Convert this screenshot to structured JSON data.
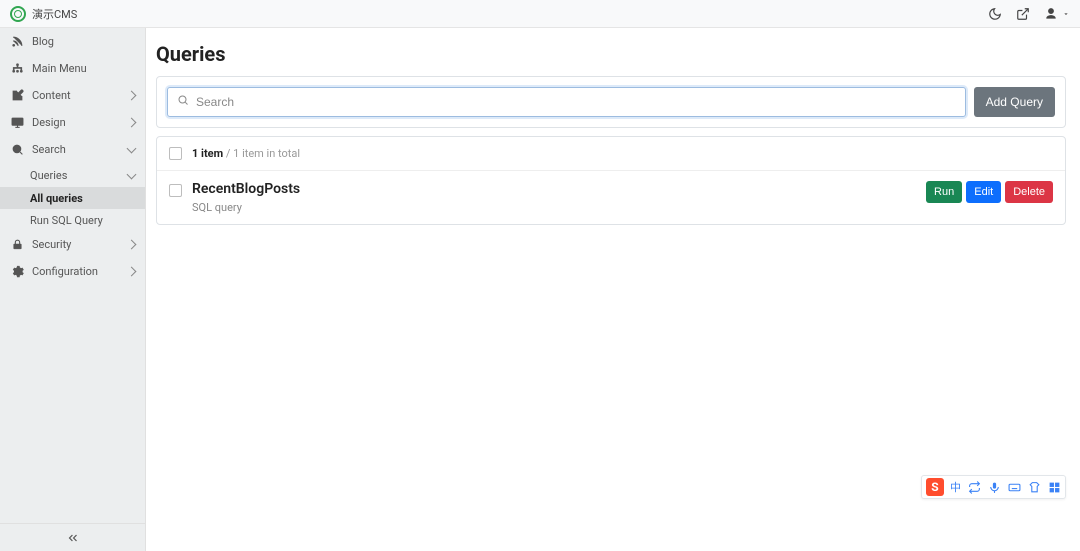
{
  "header": {
    "title": "演示CMS"
  },
  "sidebar": {
    "items": [
      {
        "label": "Blog"
      },
      {
        "label": "Main Menu"
      },
      {
        "label": "Content"
      },
      {
        "label": "Design"
      },
      {
        "label": "Search",
        "children": [
          {
            "label": "Queries",
            "children": [
              {
                "label": "All queries",
                "active": true
              },
              {
                "label": "Run SQL Query"
              }
            ]
          }
        ]
      },
      {
        "label": "Security"
      },
      {
        "label": "Configuration"
      }
    ]
  },
  "main": {
    "title": "Queries",
    "search_placeholder": "Search",
    "add_button": "Add Query",
    "list": {
      "count_number": "1 item",
      "count_rest": " / 1 item in total",
      "rows": [
        {
          "title": "RecentBlogPosts",
          "subtitle": "SQL query",
          "actions": {
            "run": "Run",
            "edit": "Edit",
            "delete": "Delete"
          }
        }
      ]
    }
  },
  "ime": {
    "badge": "S",
    "lang": "中"
  }
}
